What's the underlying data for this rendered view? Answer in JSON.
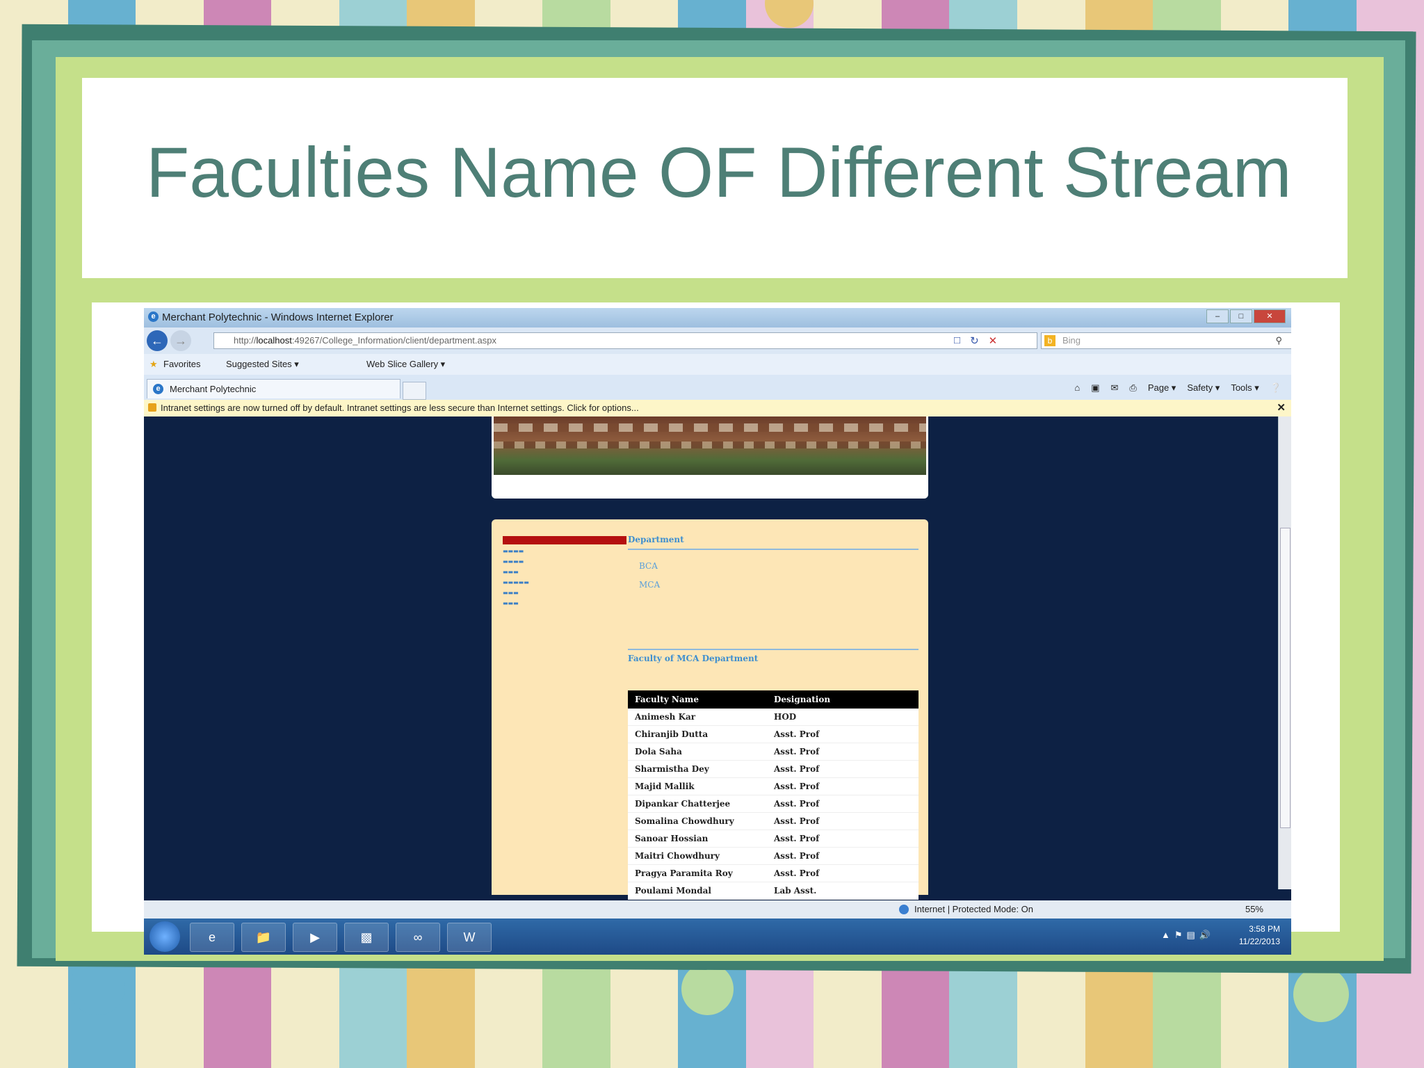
{
  "slide": {
    "title": "Faculties Name OF Different Stream"
  },
  "browser": {
    "window_title": "Merchant Polytechnic - Windows Internet Explorer",
    "url_prefix": "http://",
    "url_host": "localhost",
    "url_path": ":49267/College_Information/client/department.aspx",
    "search_placeholder": "Bing",
    "favorites_label": "Favorites",
    "suggested_sites": "Suggested Sites ▾",
    "web_slice_gallery": "Web Slice Gallery ▾",
    "tab_title": "Merchant Polytechnic",
    "cmd_page": "Page ▾",
    "cmd_safety": "Safety ▾",
    "cmd_tools": "Tools ▾",
    "info_bar": "Intranet settings are now turned off by default. Intranet settings are less secure than Internet settings. Click for options...",
    "status_zone": "Internet | Protected Mode: On",
    "zoom": "55%"
  },
  "page": {
    "department_heading": "Department",
    "departments": [
      "BCA",
      "MCA"
    ],
    "faculty_heading": "Faculty of MCA Department",
    "table_headers": [
      "Faculty Name",
      "Designation"
    ],
    "faculty": [
      {
        "name": "Animesh Kar",
        "designation": "HOD"
      },
      {
        "name": "Chiranjib Dutta",
        "designation": "Asst. Prof"
      },
      {
        "name": "Dola Saha",
        "designation": "Asst. Prof"
      },
      {
        "name": "Sharmistha Dey",
        "designation": "Asst. Prof"
      },
      {
        "name": "Majid Mallik",
        "designation": "Asst. Prof"
      },
      {
        "name": "Dipankar Chatterjee",
        "designation": "Asst. Prof"
      },
      {
        "name": "Somalina Chowdhury",
        "designation": "Asst. Prof"
      },
      {
        "name": "Sanoar Hossian",
        "designation": "Asst. Prof"
      },
      {
        "name": "Maitri Chowdhury",
        "designation": "Asst. Prof"
      },
      {
        "name": "Pragya Paramita Roy",
        "designation": "Asst. Prof"
      },
      {
        "name": "Poulami Mondal",
        "designation": "Lab Asst."
      }
    ]
  },
  "taskbar": {
    "time": "3:58 PM",
    "date": "11/22/2013"
  },
  "colors": {
    "title": "#4e7f76",
    "page_bg": "#0d2144",
    "panel": "#fde6b6",
    "link": "#3f8fcf"
  }
}
